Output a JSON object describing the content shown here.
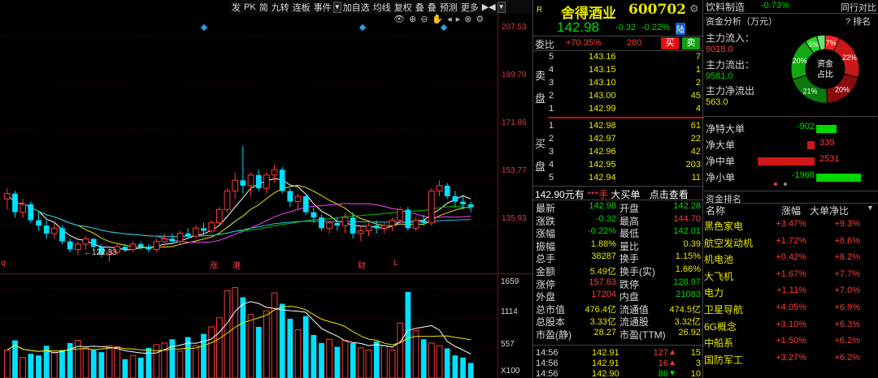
{
  "toolbar": {
    "items": [
      "发",
      "PK",
      "简",
      "九转",
      "连板",
      "事件",
      "加自选",
      "均线",
      "复权",
      "叠",
      "叠",
      "预测",
      "更多"
    ]
  },
  "chart": {
    "price_axis": [
      "207.53",
      "189.70",
      "171.86",
      "153.77",
      "135.93"
    ],
    "volume_axis": [
      "1659",
      "1114",
      "557",
      "X100"
    ],
    "low_marker": "←122.33",
    "event_markers": [
      "q",
      "涨",
      "港",
      "财",
      "L"
    ]
  },
  "chart_data": {
    "type": "candlestick",
    "title": "",
    "ylim": [
      118,
      212
    ],
    "price_ticks": [
      207.53,
      189.7,
      171.86,
      153.77,
      135.93
    ],
    "candles": [
      [
        146,
        150,
        142,
        148
      ],
      [
        148,
        149,
        139,
        141
      ],
      [
        141,
        146,
        139,
        144
      ],
      [
        144,
        145,
        137,
        138
      ],
      [
        138,
        141,
        134,
        136
      ],
      [
        136,
        138,
        131,
        133
      ],
      [
        133,
        137,
        131,
        135
      ],
      [
        135,
        136,
        129,
        130
      ],
      [
        130,
        131,
        126,
        127
      ],
      [
        127,
        130,
        125,
        129
      ],
      [
        129,
        132,
        127,
        131
      ],
      [
        131,
        131,
        127,
        128
      ],
      [
        128,
        129,
        124,
        125
      ],
      [
        125,
        127,
        122.33,
        126
      ],
      [
        126,
        129,
        125,
        128
      ],
      [
        128,
        129,
        126,
        127
      ],
      [
        127,
        130,
        126,
        129
      ],
      [
        129,
        130,
        127,
        128
      ],
      [
        128,
        129,
        126,
        127
      ],
      [
        127,
        131,
        126,
        130
      ],
      [
        130,
        133,
        128,
        131
      ],
      [
        131,
        133,
        129,
        130
      ],
      [
        130,
        134,
        129,
        133
      ],
      [
        133,
        135,
        131,
        132
      ],
      [
        132,
        136,
        131,
        135
      ],
      [
        135,
        137,
        133,
        134
      ],
      [
        134,
        138,
        133,
        137
      ],
      [
        137,
        143,
        136,
        142
      ],
      [
        142,
        150,
        141,
        149
      ],
      [
        149,
        156,
        146,
        153
      ],
      [
        153,
        166,
        148,
        151
      ],
      [
        151,
        156,
        147,
        155
      ],
      [
        155,
        157,
        149,
        150
      ],
      [
        150,
        156,
        148,
        155
      ],
      [
        155,
        159,
        152,
        157
      ],
      [
        157,
        158,
        148,
        149
      ],
      [
        149,
        150,
        143,
        145
      ],
      [
        145,
        148,
        142,
        147
      ],
      [
        147,
        148,
        140,
        141
      ],
      [
        141,
        143,
        137,
        139
      ],
      [
        139,
        140,
        134,
        135
      ],
      [
        135,
        138,
        133,
        137
      ],
      [
        137,
        139,
        134,
        136
      ],
      [
        136,
        141,
        133,
        139
      ],
      [
        139,
        141,
        131,
        133
      ],
      [
        133,
        136,
        130,
        134
      ],
      [
        134,
        137,
        132,
        136
      ],
      [
        136,
        138,
        133,
        135
      ],
      [
        135,
        137,
        133,
        136
      ],
      [
        136,
        139,
        134,
        138
      ],
      [
        138,
        143,
        137,
        142
      ],
      [
        142,
        143,
        134,
        135
      ],
      [
        135,
        139,
        134,
        138
      ],
      [
        138,
        140,
        136,
        137
      ],
      [
        137,
        150,
        136,
        149
      ],
      [
        149,
        153,
        147,
        151
      ],
      [
        151,
        152,
        146,
        147
      ],
      [
        147,
        149,
        143,
        145
      ],
      [
        145,
        147,
        142,
        144
      ],
      [
        144,
        145,
        141,
        142.98
      ]
    ],
    "volumes": [
      520,
      700,
      380,
      450,
      420,
      600,
      480,
      520,
      650,
      700,
      560,
      520,
      480,
      600,
      580,
      350,
      420,
      380,
      560,
      620,
      650,
      720,
      500,
      760,
      600,
      820,
      950,
      1120,
      1620,
      1680,
      1500,
      1180,
      950,
      1250,
      1580,
      1380,
      1100,
      900,
      1150,
      800,
      650,
      720,
      580,
      700,
      650,
      560,
      520,
      680,
      600,
      520,
      1020,
      1600,
      880,
      720,
      650,
      600,
      550,
      420,
      380,
      280
    ]
  },
  "quote": {
    "stock_name": "舍得酒业",
    "stock_code": "600702",
    "r_label": "R",
    "price": "142.98",
    "change": "-0.32",
    "change_pct": "-0.22%",
    "market_tag": "陆",
    "webi_label": "委比",
    "webi_value": "+70.35%",
    "webi_diff": "280",
    "buy_btn": "买",
    "sell_btn": "卖",
    "sell_label": [
      "卖",
      "盘"
    ],
    "buy_label": [
      "买",
      "盘"
    ],
    "asks": [
      {
        "level": "5",
        "price": "143.16",
        "vol": "7"
      },
      {
        "level": "4",
        "price": "143.15",
        "vol": "1"
      },
      {
        "level": "3",
        "price": "143.10",
        "vol": "2"
      },
      {
        "level": "2",
        "price": "143.00",
        "vol": "45"
      },
      {
        "level": "1",
        "price": "142.99",
        "vol": "4"
      }
    ],
    "bids": [
      {
        "level": "1",
        "price": "142.98",
        "vol": "61"
      },
      {
        "level": "2",
        "price": "142.97",
        "vol": "22"
      },
      {
        "level": "3",
        "price": "142.96",
        "vol": "42"
      },
      {
        "level": "4",
        "price": "142.95",
        "vol": "203"
      },
      {
        "level": "5",
        "price": "142.94",
        "vol": "11"
      }
    ],
    "big_order_line": {
      "a": "142.90元有",
      "b": "***手",
      "c": "大买单",
      "d": "点击查看"
    },
    "stats": [
      {
        "l1": "最新",
        "v1": "142.98",
        "l2": "开盘",
        "v2": "142.28"
      },
      {
        "l1": "涨跌",
        "v1": "-0.32",
        "l2": "最高",
        "v2": "144.70"
      },
      {
        "l1": "涨幅",
        "v1": "-0.22%",
        "l2": "最低",
        "v2": "142.01"
      },
      {
        "l1": "振幅",
        "v1": "1.88%",
        "l2": "量比",
        "v2": "0.39"
      },
      {
        "l1": "总手",
        "v1": "38287",
        "l2": "换手",
        "v2": "1.15%"
      },
      {
        "l1": "金额",
        "v1": "5.49亿",
        "l2": "换手(实)",
        "v2": "1.66%"
      },
      {
        "l1": "涨停",
        "v1": "157.63",
        "l2": "跌停",
        "v2": "128.97"
      },
      {
        "l1": "外盘",
        "v1": "17204",
        "l2": "内盘",
        "v2": "21083"
      },
      {
        "l1": "总市值",
        "v1": "476.4亿",
        "l2": "流通值",
        "v2": "474.5亿"
      },
      {
        "l1": "总股本",
        "v1": "3.33亿",
        "l2": "流通股",
        "v2": "3.32亿"
      },
      {
        "l1": "市盈(静)",
        "v1": "28.27",
        "l2": "市盈(TTM)",
        "v2": "26.92"
      }
    ],
    "ticks": [
      {
        "time": "14:56",
        "price": "142.91",
        "vol": "127",
        "dir": "up",
        "count": "15"
      },
      {
        "time": "14:56",
        "price": "142.91",
        "vol": "16",
        "dir": "up",
        "count": "3"
      },
      {
        "time": "14:56",
        "price": "142.90",
        "vol": "86",
        "dir": "down",
        "count": "10"
      }
    ]
  },
  "right": {
    "sector_name": "饮料制造",
    "sector_change": "-0.73%",
    "sector_compare": "同行对比",
    "fund_title": "资金分析（万元）",
    "rank_label": "排名",
    "inflow_label": "主力流入：",
    "inflow_value": "9018.0",
    "outflow_label": "主力流出：",
    "outflow_value": "9581.0",
    "net_label": "主力净流出",
    "net_value": "563.0",
    "donut_center": [
      "资金",
      "占比"
    ],
    "donut": [
      {
        "pct": 7,
        "label": "7%",
        "color": "#ff2020"
      },
      {
        "pct": 22,
        "label": "22%",
        "color": "#c81818"
      },
      {
        "pct": 20,
        "label": "20%",
        "color": "#8a0d0d"
      },
      {
        "pct": 21,
        "label": "21%",
        "color": "#0a7a0a"
      },
      {
        "pct": 20,
        "label": "20%",
        "color": "#12a812"
      },
      {
        "pct": 6,
        "label": "6%",
        "color": "#20d820"
      },
      {
        "pct": 4,
        "label": "",
        "color": "#6ee06e"
      }
    ],
    "flows": [
      {
        "label": "净特大单",
        "value": "-902",
        "fill": 0.36
      },
      {
        "label": "净大单",
        "value": "339",
        "fill": 0.13
      },
      {
        "label": "净中单",
        "value": "2531",
        "fill": 1.0
      },
      {
        "label": "净小单",
        "value": "-1968",
        "fill": 0.78
      }
    ],
    "rank_title": "资金排名",
    "rank_headers": [
      "名称",
      "涨幅",
      "大单净比"
    ],
    "sectors": [
      {
        "name": "黑色家电",
        "change": "+3.47%",
        "ratio": "+9.3%"
      },
      {
        "name": "航空发动机",
        "change": "+1.72%",
        "ratio": "+8.6%"
      },
      {
        "name": "机电池",
        "change": "+0.42%",
        "ratio": "+8.2%"
      },
      {
        "name": "大飞机",
        "change": "+1.67%",
        "ratio": "+7.7%"
      },
      {
        "name": "电力",
        "change": "+1.11%",
        "ratio": "+7.0%"
      },
      {
        "name": "卫星导航",
        "change": "+4.05%",
        "ratio": "+6.9%"
      },
      {
        "name": "6G概念",
        "change": "+3.10%",
        "ratio": "+6.3%"
      },
      {
        "name": "中船系",
        "change": "+1.50%",
        "ratio": "+6.2%"
      },
      {
        "name": "国防军工",
        "change": "+3.27%",
        "ratio": "+6.2%"
      }
    ],
    "colors": {
      "up": "#ff3b3b",
      "down": "#00d800",
      "label": "#e8e800"
    }
  }
}
